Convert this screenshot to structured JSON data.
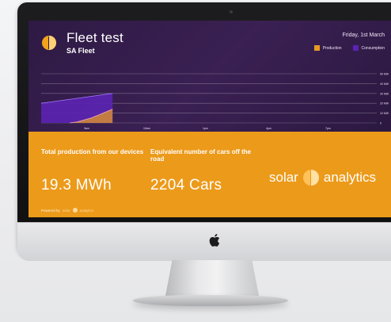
{
  "dashboard": {
    "title": "Fleet test",
    "subtitle": "SA Fleet",
    "date": "Friday, 1st March",
    "legend": [
      {
        "label": "Production",
        "color": "#e69a22"
      },
      {
        "label": "Consumption",
        "color": "#5b23b3"
      }
    ]
  },
  "chart_data": {
    "type": "area",
    "x_ticks": [
      "3am",
      "10am",
      "1pm",
      "4pm",
      "7pm"
    ],
    "y_ticks": [
      "50 MW",
      "40 MW",
      "30 MW",
      "20 MW",
      "10 MW",
      "0"
    ],
    "series": [
      {
        "name": "Consumption",
        "color": "#5b23b3",
        "x": [
          0,
          1,
          2,
          3,
          4,
          5,
          6,
          7,
          8,
          9,
          10
        ],
        "values": [
          20,
          21,
          22,
          23,
          24,
          25,
          26,
          27,
          28,
          29,
          30
        ]
      },
      {
        "name": "Production",
        "color": "#e69a22",
        "x": [
          4,
          5,
          6,
          7,
          8,
          9,
          10
        ],
        "values": [
          0,
          1,
          3,
          5,
          8,
          11,
          14
        ]
      }
    ],
    "ylim": [
      0,
      50
    ],
    "grid": true
  },
  "stats": {
    "production_label": "Total production from our devices",
    "production_value": "19.3 MWh",
    "cars_label": "Equivalent number of cars off the road",
    "cars_value": "2204 Cars"
  },
  "brand": {
    "name_left": "solar",
    "name_right": "analytics",
    "powered_by": "Powered by"
  }
}
